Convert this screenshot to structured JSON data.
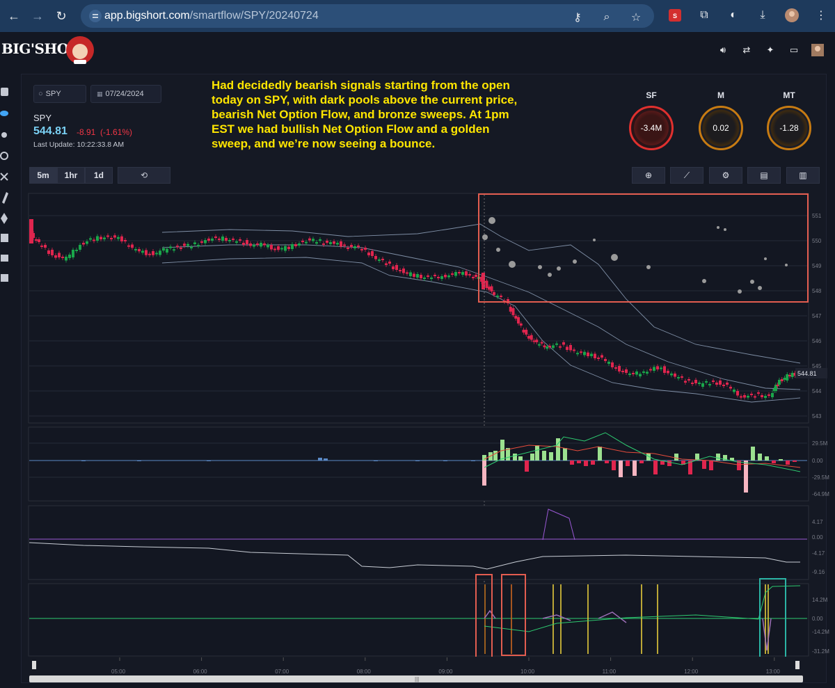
{
  "browser": {
    "url_domain": "app.bigshort.com",
    "url_path": "/smartflow/SPY/20240724"
  },
  "app": {
    "logo_text": "BIG'SHORT"
  },
  "controls": {
    "symbol_input": "SPY",
    "date_input": "07/24/2024",
    "timeframes": [
      "5m",
      "1hr",
      "1d"
    ],
    "active_timeframe": "5m"
  },
  "quote": {
    "ticker": "SPY",
    "price": "544.81",
    "change": "-8.91",
    "change_pct": "(-1.61%)",
    "last_update": "Last Update: 10:22:33.8 AM"
  },
  "annotation": "Had decidedly bearish signals starting from the open today on SPY, with dark pools above the current price, bearish Net Option Flow, and bronze sweeps. At 1pm EST we had bullish Net Option Flow and a golden sweep, and we’re now seeing a bounce.",
  "gauges": [
    {
      "label": "SF",
      "value": "-3.4M",
      "color": "#e0302e"
    },
    {
      "label": "M",
      "value": "0.02",
      "color": "#e08b1a"
    },
    {
      "label": "MT",
      "value": "-1.28",
      "color": "#e08b1a"
    }
  ],
  "chart_data": {
    "type": "candlestick",
    "price_axis_labels": [
      "551",
      "550",
      "549",
      "548",
      "547",
      "546",
      "545",
      "544",
      "543"
    ],
    "current_price_label": "544.81",
    "flow_axis_labels": [
      "29.5M",
      "0.00",
      "-29.5M",
      "-64.9M"
    ],
    "sweep_axis_labels": [
      "4.17",
      "0.00",
      "-4.17",
      "-9.16"
    ],
    "gex_axis_labels": [
      "14.2M",
      "0.00",
      "-14.2M",
      "-31.2M"
    ],
    "time_labels": [
      "05:00",
      "06:00",
      "07:00",
      "08:00",
      "09:00",
      "10:00",
      "11:00",
      "12:00",
      "13:00"
    ]
  }
}
